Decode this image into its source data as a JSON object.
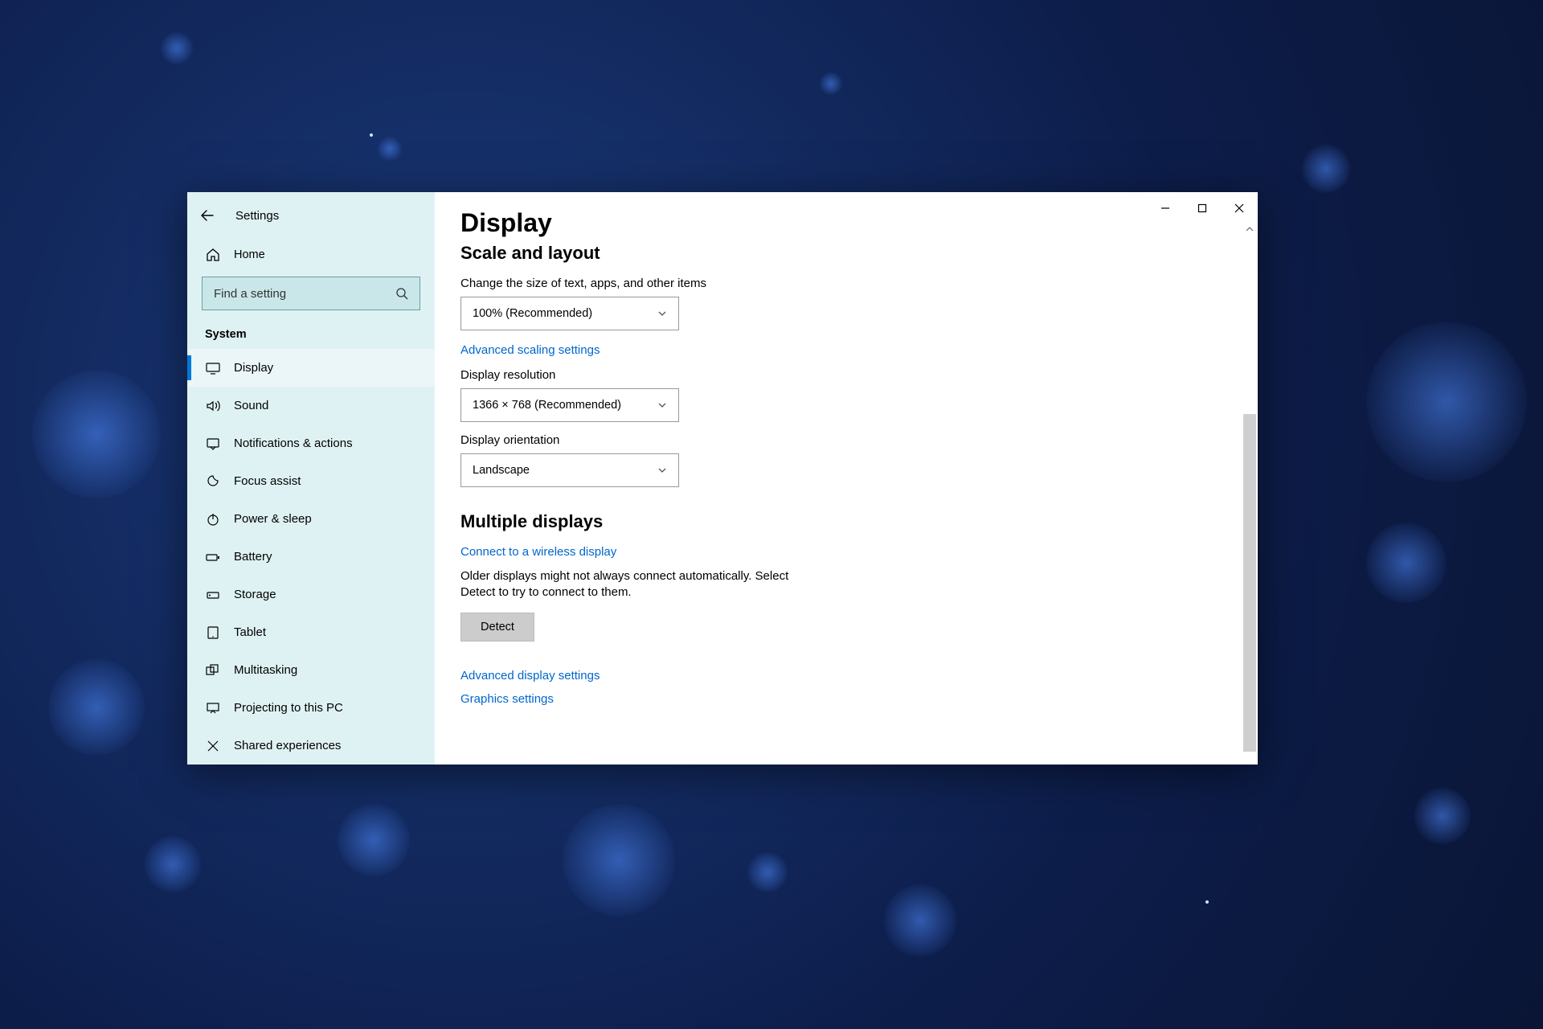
{
  "window": {
    "title": "Settings"
  },
  "home": {
    "label": "Home"
  },
  "search": {
    "placeholder": "Find a setting"
  },
  "category": "System",
  "sidebar": {
    "items": [
      {
        "label": "Display"
      },
      {
        "label": "Sound"
      },
      {
        "label": "Notifications & actions"
      },
      {
        "label": "Focus assist"
      },
      {
        "label": "Power & sleep"
      },
      {
        "label": "Battery"
      },
      {
        "label": "Storage"
      },
      {
        "label": "Tablet"
      },
      {
        "label": "Multitasking"
      },
      {
        "label": "Projecting to this PC"
      },
      {
        "label": "Shared experiences"
      }
    ]
  },
  "page": {
    "title": "Display",
    "section1": "Scale and layout",
    "scale_label": "Change the size of text, apps, and other items",
    "scale_value": "100% (Recommended)",
    "advanced_scaling": "Advanced scaling settings",
    "resolution_label": "Display resolution",
    "resolution_value": "1366 × 768 (Recommended)",
    "orientation_label": "Display orientation",
    "orientation_value": "Landscape",
    "section2": "Multiple displays",
    "connect_wireless": "Connect to a wireless display",
    "detect_hint": "Older displays might not always connect automatically. Select Detect to try to connect to them.",
    "detect_button": "Detect",
    "advanced_display": "Advanced display settings",
    "graphics_settings": "Graphics settings"
  }
}
